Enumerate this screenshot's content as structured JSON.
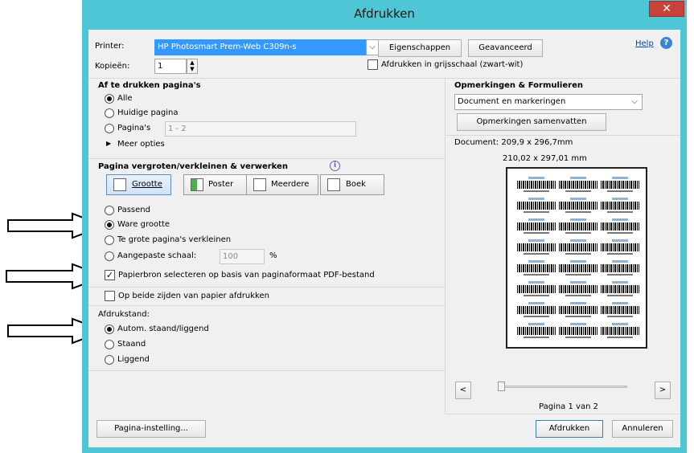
{
  "window": {
    "title": "Afdrukken",
    "close": "✕"
  },
  "printer": {
    "label": "Printer:",
    "value": "HP Photosmart Prem-Web C309n-s",
    "properties": "Eigenschappen",
    "advanced": "Geavanceerd",
    "help": "Help",
    "copies_label": "Kopieën:",
    "copies_value": "1",
    "grayscale": "Afdrukken in grijsschaal (zwart-wit)"
  },
  "pages": {
    "heading": "Af te drukken pagina's",
    "all": "Alle",
    "current": "Huidige pagina",
    "pages": "Pagina's",
    "range": "1 - 2",
    "more": "Meer opties"
  },
  "sizing": {
    "heading": "Pagina vergroten/verkleinen & verwerken",
    "btn_size": "Grootte",
    "btn_poster": "Poster",
    "btn_multiple": "Meerdere",
    "btn_booklet": "Boek",
    "fit": "Passend",
    "actual": "Ware grootte",
    "shrink": "Te grote pagina's verkleinen",
    "custom": "Aangepaste schaal:",
    "custom_value": "100",
    "percent": "%",
    "paper_source": "Papierbron selecteren op basis van paginaformaat PDF-bestand"
  },
  "duplex": {
    "label": "Op beide zijden van papier afdrukken"
  },
  "orientation": {
    "heading": "Afdrukstand:",
    "auto": "Autom. staand/liggend",
    "portrait": "Staand",
    "landscape": "Liggend"
  },
  "comments": {
    "heading": "Opmerkingen & Formulieren",
    "value": "Document en markeringen",
    "summarize": "Opmerkingen samenvatten"
  },
  "preview": {
    "document_size": "Document: 209,9 x 296,7mm",
    "page_size": "210,02 x 297,01 mm",
    "prev": "<",
    "next": ">",
    "page_indicator": "Pagina 1 van 2"
  },
  "footer": {
    "page_setup": "Pagina-instelling...",
    "print": "Afdrukken",
    "cancel": "Annuleren"
  }
}
